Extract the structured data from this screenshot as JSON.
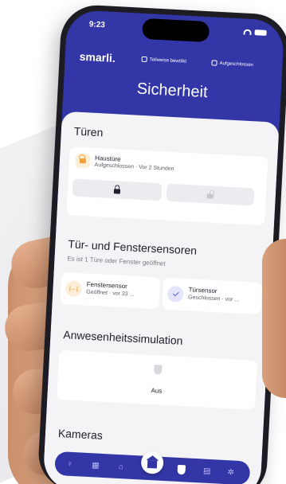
{
  "status_bar": {
    "time": "9:23"
  },
  "header": {
    "brand": "smarli.",
    "status_people": "Teilweise bewölkt",
    "status_lock": "Aufgeschlossen",
    "title": "Sicherheit"
  },
  "doors": {
    "title": "Türen",
    "device_name": "Haustüre",
    "device_status": "Aufgeschlossen · Vor 2 Stunden"
  },
  "sensors": {
    "title": "Tür- und Fenstersensoren",
    "subtitle": "Es ist 1 Türe oder Fenster geöffnet",
    "items": [
      {
        "name": "Fenstersensor",
        "status": "Geöffnet · vor 33 ..."
      },
      {
        "name": "Türsensor",
        "status": "Geschlossen · vor ..."
      }
    ]
  },
  "presence": {
    "title": "Anwesenheitssimulation",
    "state": "Aus"
  },
  "cameras": {
    "title": "Kameras"
  },
  "bottom_nav": {
    "items": [
      "lightbulb-icon",
      "store-icon",
      "house-outline-icon",
      "home-icon",
      "shield-icon",
      "list-icon",
      "settings-icon"
    ],
    "active": "home-icon"
  },
  "colors": {
    "primary": "#3336a6",
    "accent_orange": "#f0a23a",
    "background": "#f4f4f6"
  }
}
